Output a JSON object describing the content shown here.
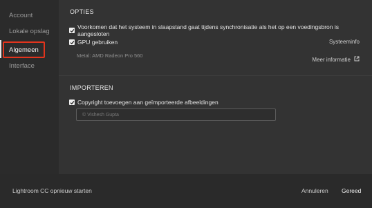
{
  "sidebar": {
    "items": [
      {
        "label": "Account"
      },
      {
        "label": "Lokale opslag"
      },
      {
        "label": "Algemeen"
      },
      {
        "label": "Interface"
      }
    ]
  },
  "options": {
    "title": "OPTIES",
    "sleep_label": "Voorkomen dat het systeem in slaapstand gaat tijdens synchronisatie als het op een voedingsbron is aangesloten",
    "gpu_label": "GPU gebruiken",
    "system_info": "Systeeminfo",
    "gpu_info": "Metal: AMD Radeon Pro 560",
    "more_info": "Meer informatie"
  },
  "import": {
    "title": "IMPORTEREN",
    "copyright_label": "Copyright toevoegen aan geïmporteerde afbeeldingen",
    "copyright_value": "© Vishesh Gupta"
  },
  "footer": {
    "restart": "Lightroom CC opnieuw starten",
    "cancel": "Annuleren",
    "done": "Gereed"
  },
  "colors": {
    "highlight": "#e2341d"
  },
  "checkboxes": {
    "sleep": true,
    "gpu": true,
    "copyright": true
  }
}
